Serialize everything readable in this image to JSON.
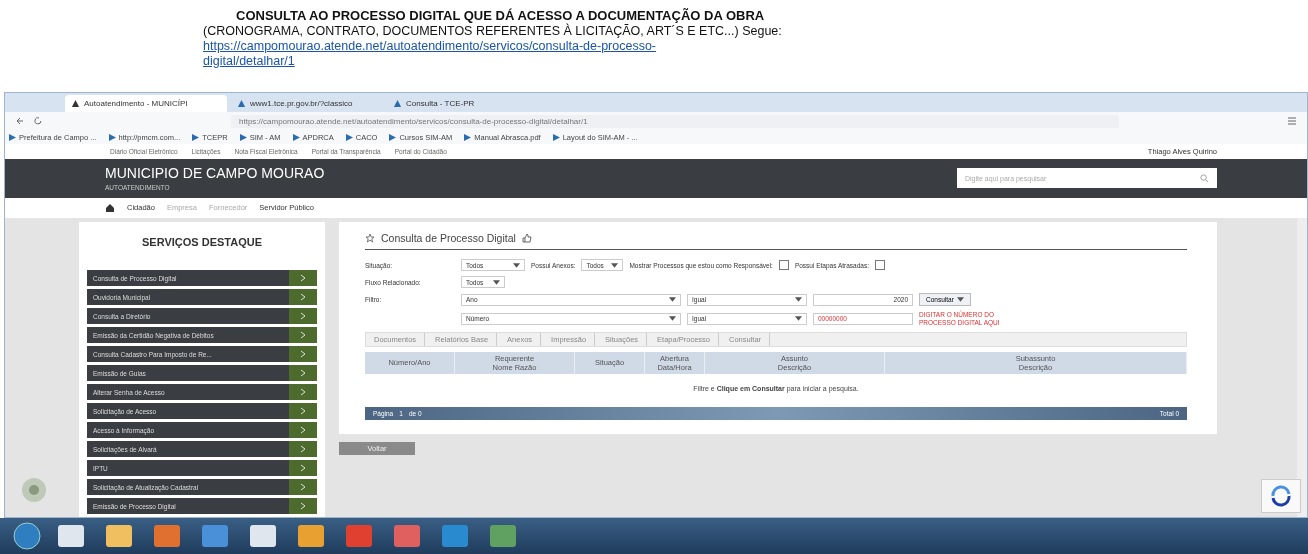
{
  "caption": {
    "title": "CONSULTA AO PROCESSO DIGITAL QUE DÁ ACESSO A DOCUMENTAÇÃO DA OBRA",
    "subtitle": "(CRONOGRAMA, CONTRATO, DOCUMENTOS REFERENTES À LICITAÇÃO, ART´S E ETC...) Segue:",
    "link_lines": [
      "https://campomourao.atende.net/autoatendimento/servicos/consulta-de-processo-",
      "digital/detalhar/1"
    ]
  },
  "browser": {
    "tabs": [
      {
        "label": "Autoatendimento - MUNICÍPI",
        "selected": true
      },
      {
        "label": "www1.tce.pr.gov.br/?classico",
        "selected": false
      },
      {
        "label": "Consulta - TCE-PR",
        "selected": false
      }
    ],
    "url": "https://campomourao.atende.net/autoatendimento/servicos/consulta-de-processo-digital/detalhar/1",
    "bookmarks": [
      "Prefeitura de Campo ...",
      "http://pmcm.com...",
      "TCEPR",
      "SIM - AM",
      "APDRCA",
      "CACO",
      "Cursos SIM-AM",
      "Manual Abrasca.pdf",
      "Layout do SIM-AM - ..."
    ],
    "top_links": [
      "Diário Oficial Eletrônico",
      "Licitações",
      "Nota Fiscal Eletrônica",
      "Portal da Transparência",
      "Portal do Cidadão"
    ],
    "user": "Thiago Alves Quirino"
  },
  "site": {
    "title": "MUNICIPIO DE CAMPO MOURAO",
    "subtitle": "AUTOATENDIMENTO",
    "search_placeholder": "Digite aqui para pesquisar",
    "nav": [
      {
        "label": "Cidadão",
        "selected": true
      },
      {
        "label": "Empresa",
        "selected": false
      },
      {
        "label": "Fornecedor",
        "selected": false
      },
      {
        "label": "Servidor Público",
        "selected": true
      }
    ]
  },
  "sidebar": {
    "title": "SERVIÇOS DESTAQUE",
    "items": [
      "Consulta de Processo Digital",
      "Ouvidoria Municipal",
      "Consulta a Diretório",
      "Emissão da Certidão Negativa de Débitos",
      "Consulta Cadastro Para Imposto de Re...",
      "Emissão de Guias",
      "Alterar Senha de Acesso",
      "Solicitação de Acesso",
      "Acesso à Informação",
      "Solicitações de Alvará",
      "IPTU",
      "Solicitação de Atualização Cadastral",
      "Emissão de Processo Digital"
    ]
  },
  "panel": {
    "title": "Consulta de Processo Digital",
    "situacao": {
      "label": "Situação:",
      "value": "Todos"
    },
    "anexos": {
      "label": "Possui Anexos:",
      "value": "Todos"
    },
    "responsavel": {
      "label": "Mostrar Processos que estou como Responsável:",
      "checked": false
    },
    "atrasadas": {
      "label": "Possui Etapas Atrasadas:",
      "checked": false
    },
    "fluxo": {
      "label": "Fluxo Relacionado:",
      "value": "Todos"
    },
    "filtro_label": "Filtro:",
    "filters": [
      {
        "field": "Ano",
        "op": "Igual",
        "value": "2020",
        "kind": "plain"
      },
      {
        "field": "Número",
        "op": "Igual",
        "value": "00000000",
        "kind": "highlight"
      }
    ],
    "consult_button": "Consultar",
    "note": "DIGITAR O NÚMERO DO PROCESSO DIGITAL AQUI",
    "toolbar": [
      "Documentos",
      "Relatórios Base",
      "Anexos",
      "Impressão",
      "Situações",
      "Etapa/Processo",
      "Consultar"
    ],
    "columns": [
      {
        "bottom": "Número/Ano"
      },
      {
        "top": "Requerente",
        "bottom": "Nome Razão"
      },
      {
        "bottom": "Situação"
      },
      {
        "top": "Abertura",
        "bottom": "Data/Hora"
      },
      {
        "top": "Assunto",
        "bottom": "Descrição"
      },
      {
        "top": "Subassunto",
        "bottom": "Descrição"
      }
    ],
    "empty_message": "Filtre e **Clique em Consultar** para iniciar a pesquisa.",
    "pager": {
      "label": "Página",
      "page": "1",
      "of": "de 0",
      "total": "Total 0"
    },
    "back_button": "Voltar"
  }
}
